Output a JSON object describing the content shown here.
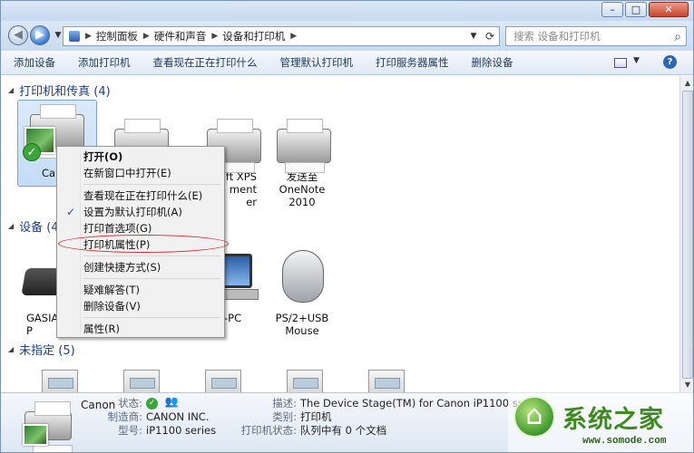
{
  "window": {
    "minimize": "–",
    "maximize": "□",
    "close": "✕"
  },
  "address": {
    "breadcrumbs": [
      "控制面板",
      "硬件和声音",
      "设备和打印机"
    ],
    "search_placeholder": "搜索 设备和打印机"
  },
  "toolbar": {
    "commands": [
      "添加设备",
      "添加打印机",
      "查看现在正在打印什么",
      "管理默认打印机",
      "打印服务器属性",
      "删除设备"
    ]
  },
  "groups": {
    "printers": {
      "label": "打印机和传真 (4)"
    },
    "devices": {
      "label": "设备 (4"
    },
    "unspecified": {
      "label": "未指定 (5)"
    }
  },
  "printer_items": [
    {
      "name": "Ca"
    },
    {
      "name": "ft XPS\nment\ner"
    },
    {
      "name": "发送至 OneNote\n2010"
    }
  ],
  "device_items": [
    {
      "name": "GASIA\nP"
    },
    {
      "name": "-PC"
    },
    {
      "name": "PS/2+USB\nMouse"
    }
  ],
  "context_menu": {
    "items": [
      "打开(O)",
      "在新窗口中打开(E)",
      "查看现在正在打印什么(E)",
      "设置为默认打印机(A)",
      "打印首选项(G)",
      "打印机属性(P)",
      "创建快捷方式(S)",
      "疑难解答(T)",
      "删除设备(V)",
      "属性(R)"
    ],
    "checkmark": "✓"
  },
  "details": {
    "device_name": "Canon",
    "labels": {
      "status": "状态:",
      "manufacturer": "制造商:",
      "model": "型号:",
      "description": "描述:",
      "category": "类别:",
      "printer_status": "打印机状态:"
    },
    "values": {
      "manufacturer": "CANON INC.",
      "model": "iP1100 series",
      "description": "The Device Stage(TM) for Canon iP1100 series",
      "category": "打印机",
      "printer_status": "队列中有 0 个文档"
    }
  },
  "watermark": {
    "name": "系统之家",
    "url": "www.somode.com"
  },
  "colors": {
    "accent": "#1e3d8c",
    "highlight_oval": "#d7262e",
    "selection": "#c4dcf6"
  }
}
